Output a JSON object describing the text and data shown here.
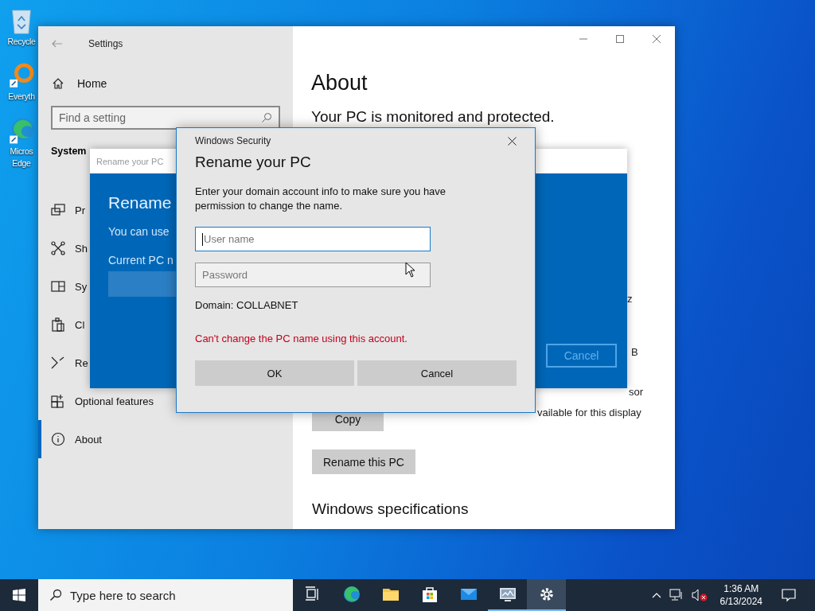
{
  "desktop_icons": [
    {
      "lines": [
        "Recycle"
      ]
    },
    {
      "lines": [
        "Everyth"
      ]
    },
    {
      "lines": [
        "Micros",
        "Edge"
      ]
    }
  ],
  "settings": {
    "title": "Settings",
    "home": "Home",
    "search": {
      "placeholder": "Find a setting"
    },
    "section": "System",
    "nav": [
      {
        "label": "Pr",
        "selected": false
      },
      {
        "label": "Sh",
        "selected": false
      },
      {
        "label": "Sy",
        "selected": false
      },
      {
        "label": "Cl",
        "selected": false
      },
      {
        "label": "Re",
        "selected": false
      },
      {
        "label": "Optional features",
        "selected": false
      },
      {
        "label": "About",
        "selected": true
      }
    ],
    "heading": "About",
    "status": "Your PC is monitored and protected.",
    "fragments": [
      "z",
      "B",
      "sor",
      "vailable for this display"
    ],
    "copy_button": "Copy",
    "rename_button": "Rename this PC",
    "specs_heading": "Windows specifications"
  },
  "rename_dialog": {
    "title": "Rename your PC",
    "heading": "Rename",
    "line": "You can use",
    "field_label": "Current PC n",
    "cancel": "Cancel"
  },
  "security_dialog": {
    "title": "Windows Security",
    "heading": "Rename your PC",
    "message": "Enter your domain account info to make sure you have permission to change the name.",
    "fields": [
      {
        "placeholder": "User name",
        "focused": true
      },
      {
        "placeholder": "Password",
        "focused": false
      }
    ],
    "domain": "Domain: COLLABNET",
    "error": "Can't change the PC name using this account.",
    "buttons": [
      "OK",
      "Cancel"
    ]
  },
  "taskbar": {
    "search": {
      "placeholder": "Type here to search"
    },
    "apps": [
      {
        "running": false,
        "selected": false
      },
      {
        "running": false,
        "selected": false
      },
      {
        "running": false,
        "selected": false
      },
      {
        "running": false,
        "selected": false
      },
      {
        "running": false,
        "selected": false
      },
      {
        "running": true,
        "selected": false
      },
      {
        "running": true,
        "selected": true
      }
    ],
    "time": "1:36 AM",
    "date": "6/13/2024"
  }
}
